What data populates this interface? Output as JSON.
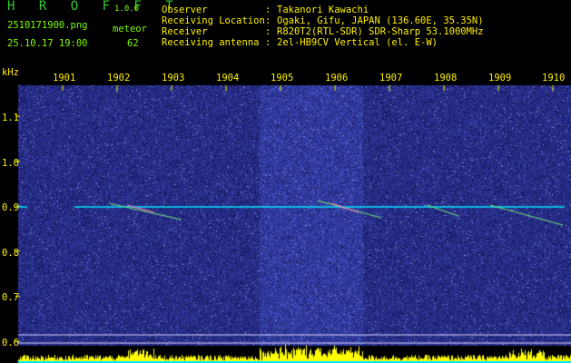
{
  "app": {
    "title": "H R O F F T",
    "version": "1.0.0"
  },
  "file": {
    "name": "2510171900.png",
    "datetime": "25.10.17 19:00"
  },
  "meteor": {
    "label": "meteor",
    "count": "62"
  },
  "info": [
    {
      "key": "Observer",
      "sep": ":",
      "value": "Takanori Kawachi"
    },
    {
      "key": "Receiving Location",
      "sep": ":",
      "value": "Ogaki, Gifu, JAPAN (136.60E, 35.35N)"
    },
    {
      "key": "Receiver",
      "sep": ":",
      "value": "R820T2(RTL-SDR) SDR-Sharp 53.1000MHz"
    },
    {
      "key": "Receiving antenna",
      "sep": ":",
      "value": "2el-HB9CV Vertical (el. E-W)"
    }
  ],
  "axis": {
    "y_unit": "kHz",
    "x_ticks": [
      "1901",
      "1902",
      "1903",
      "1904",
      "1905",
      "1906",
      "1907",
      "1908",
      "1909",
      "1910"
    ],
    "y_ticks": [
      "1.1",
      "1.0",
      "0.9",
      "0.8",
      "0.7",
      "0.6"
    ]
  },
  "colors": {
    "background": "#1a1a8c",
    "carrier": "#00e5ff",
    "baseline": "#ffff00",
    "text_green": "#7CFC00",
    "text_yellow": "#FFF000"
  }
}
